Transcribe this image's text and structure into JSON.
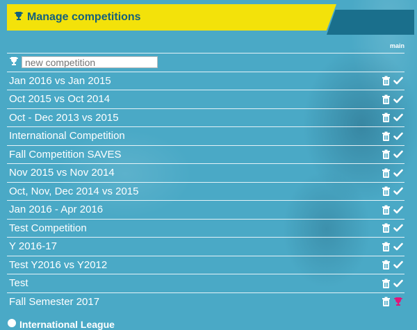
{
  "header": {
    "title": "Manage competitions"
  },
  "tab_label": "main",
  "new_competition": {
    "placeholder": "new competition"
  },
  "competitions": [
    {
      "name": "Jan 2016 vs Jan 2015",
      "status": "check"
    },
    {
      "name": "Oct 2015 vs Oct 2014",
      "status": "check"
    },
    {
      "name": "Oct - Dec 2013 vs 2015",
      "status": "check"
    },
    {
      "name": "International Competition",
      "status": "check"
    },
    {
      "name": "Fall Competition SAVES",
      "status": "check"
    },
    {
      "name": "Nov 2015 vs Nov 2014",
      "status": "check"
    },
    {
      "name": "Oct, Nov, Dec 2014 vs 2015",
      "status": "check"
    },
    {
      "name": "Jan 2016 - Apr 2016",
      "status": "check"
    },
    {
      "name": "Test Competition",
      "status": "check"
    },
    {
      "name": "Y 2016-17",
      "status": "check"
    },
    {
      "name": "Test Y2016 vs Y2012",
      "status": "check"
    },
    {
      "name": "Test",
      "status": "check"
    },
    {
      "name": "Fall Semester 2017",
      "status": "trophy"
    }
  ],
  "footer": {
    "label": "International League"
  },
  "colors": {
    "background": "#4aa9c6",
    "header_yellow": "#f3e20a",
    "header_dark": "#1a6f8c",
    "title_text": "#14607d",
    "active_trophy": "#e0167a"
  }
}
